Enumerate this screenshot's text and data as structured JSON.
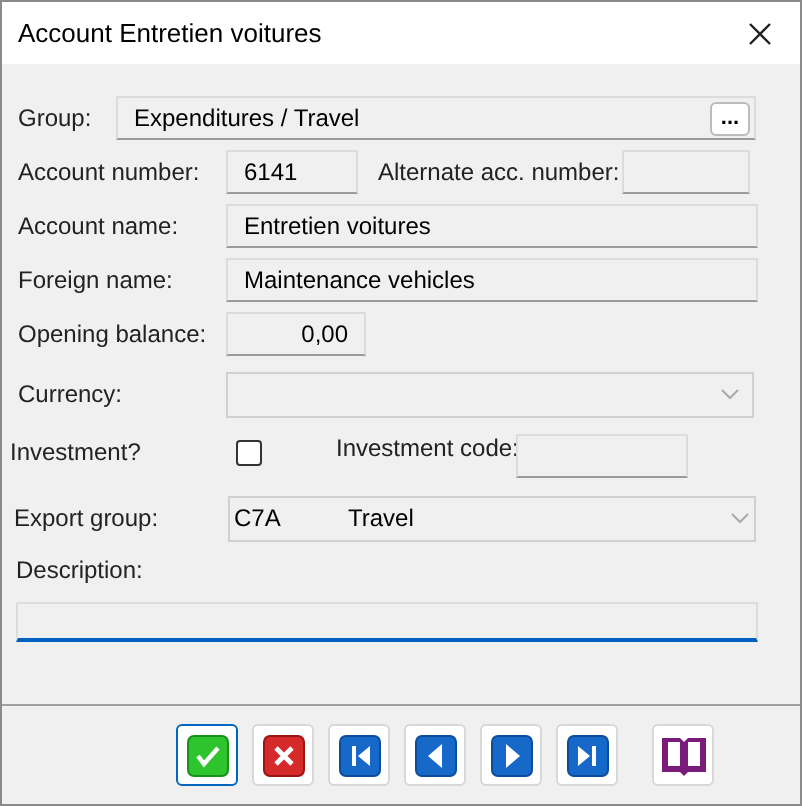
{
  "window": {
    "title": "Account Entretien voitures"
  },
  "group": {
    "label": "Group:",
    "value": "Expenditures / Travel",
    "browse": "..."
  },
  "account_number": {
    "label": "Account number:",
    "value": "6141"
  },
  "alternate_number": {
    "label": "Alternate acc. number:"
  },
  "account_name": {
    "label": "Account name:",
    "value": "Entretien voitures"
  },
  "foreign_name": {
    "label": "Foreign name:",
    "value": "Maintenance vehicles"
  },
  "opening_balance": {
    "label": "Opening balance:",
    "value": "0,00"
  },
  "currency": {
    "label": "Currency:"
  },
  "investment": {
    "label": "Investment?",
    "checked": false
  },
  "investment_code": {
    "label": "Investment code:"
  },
  "export_group": {
    "label": "Export group:",
    "code": "C7A",
    "name": "Travel"
  },
  "description": {
    "label": "Description:",
    "focused": true
  },
  "buttons": [
    {
      "kind": "ok",
      "focused": true
    },
    {
      "kind": "cancel",
      "focused": false
    },
    {
      "kind": "first",
      "focused": false
    },
    {
      "kind": "prev",
      "focused": false
    },
    {
      "kind": "next",
      "focused": false
    },
    {
      "kind": "last",
      "focused": false
    },
    {
      "kind": "book",
      "focused": false
    }
  ]
}
